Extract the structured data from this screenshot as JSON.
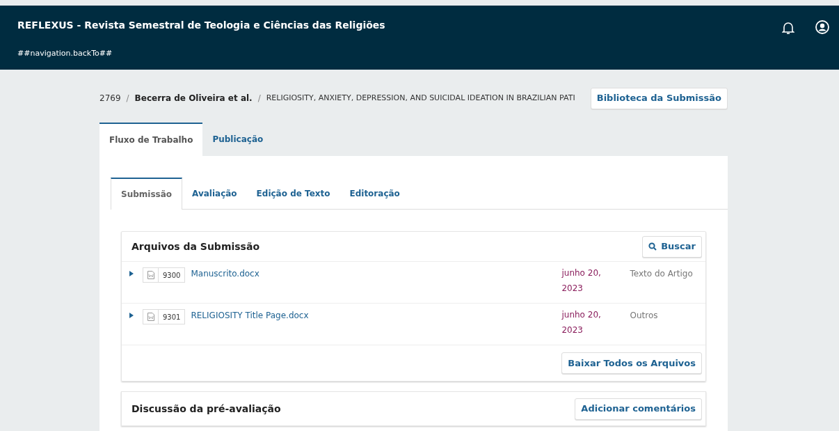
{
  "header": {
    "title": "REFLEXUS - Revista Semestral de Teologia e Ciências das Religiões",
    "back_link": "##navigation.backTo##"
  },
  "breadcrumb": {
    "separators": [
      "/",
      "/"
    ],
    "id": "2769",
    "authors": "Becerra de Oliveira et al.",
    "title": "RELIGIOSITY, ANXIETY, DEPRESSION, AND SUICIDAL IDEATION IN BRAZILIAN PATI",
    "library_button": "Biblioteca da Submissão"
  },
  "tabs": [
    {
      "label": "Fluxo de Trabalho",
      "selected": true
    },
    {
      "label": "Publicação",
      "selected": false
    }
  ],
  "stage_tabs": [
    {
      "label": "Submissão",
      "selected": true
    },
    {
      "label": "Avaliação",
      "selected": false
    },
    {
      "label": "Edição de Texto",
      "selected": false
    },
    {
      "label": "Editoração",
      "selected": false
    }
  ],
  "files_panel": {
    "title": "Arquivos da Submissão",
    "search_button": "Buscar",
    "files": [
      {
        "id": "9300",
        "name": "Manuscrito.docx",
        "date": "junho 20, 2023",
        "type": "Texto do Artigo",
        "expanded": false
      },
      {
        "id": "9301",
        "name": "RELIGIOSITY Title Page.docx",
        "date": "junho 20, 2023",
        "type": "Outros",
        "expanded": false
      }
    ],
    "download_button": "Baixar Todos os Arquivos"
  },
  "discussion_panel": {
    "title": "Discussão da pré-avaliação",
    "add_button": "Adicionar comentários"
  }
}
